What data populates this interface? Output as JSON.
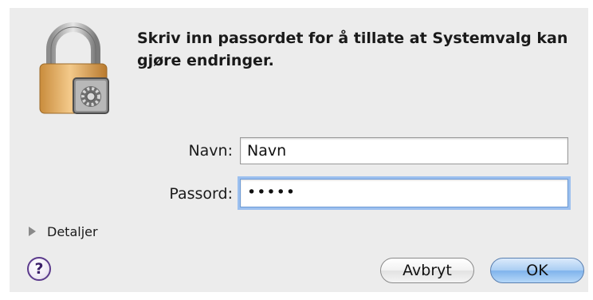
{
  "dialog": {
    "prompt": "Skriv inn passordet for å tillate at Systemvalg kan gjøre endringer."
  },
  "form": {
    "name_label": "Navn:",
    "name_value": "Navn",
    "password_label": "Passord:",
    "password_value": "•••••"
  },
  "details_label": "Detaljer",
  "help_label": "?",
  "buttons": {
    "cancel": "Avbryt",
    "ok": "OK"
  },
  "icons": {
    "lock": "lock-icon",
    "prefs_badge": "system-preferences-icon",
    "disclosure": "disclosure-triangle-icon",
    "help": "help-icon"
  },
  "colors": {
    "dialog_bg": "#ececec",
    "focus_ring": "#9cc0ef",
    "default_button": "#7fb3ec",
    "help_ring": "#5b3a8c"
  }
}
